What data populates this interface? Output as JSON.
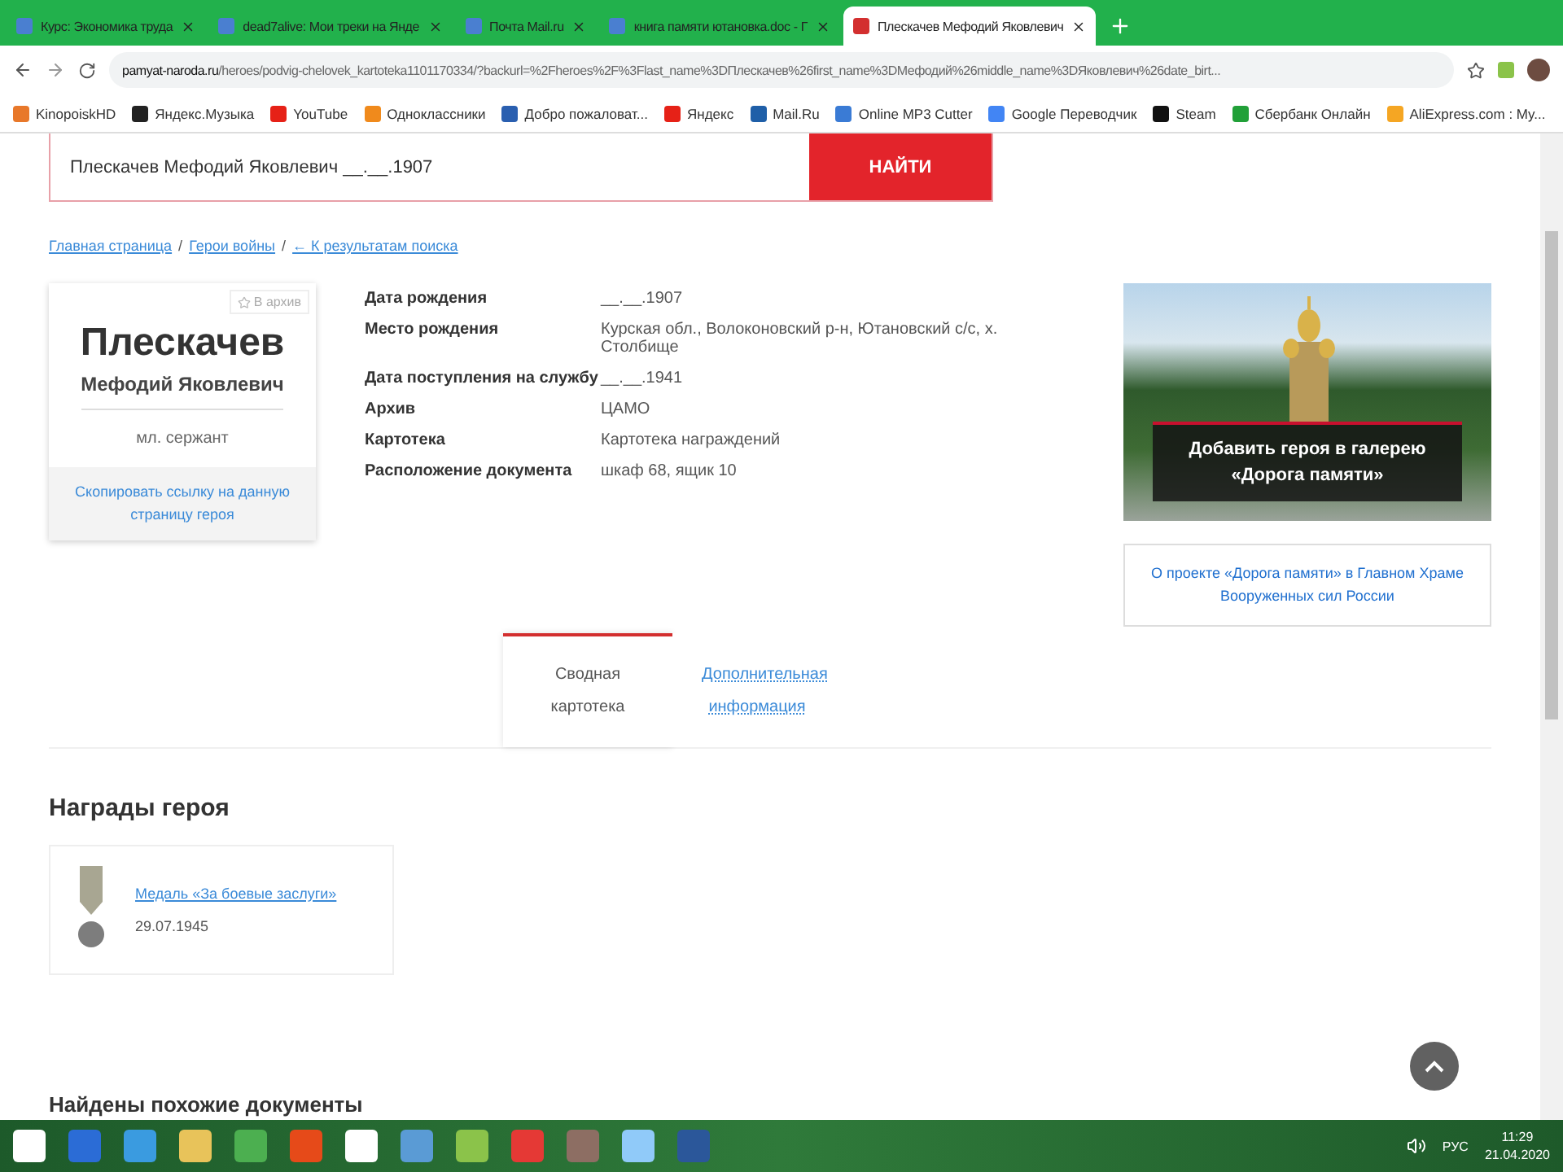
{
  "browser_tabs": [
    {
      "title": "Курс: Экономика труда",
      "selected": false
    },
    {
      "title": "dead7alive: Мои треки на Янде",
      "selected": false
    },
    {
      "title": "Почта Mail.ru",
      "selected": false
    },
    {
      "title": "книга памяти ютановка.doc - Г",
      "selected": false
    },
    {
      "title": "Плескачев Мефодий Яковлевич",
      "selected": true
    }
  ],
  "address": {
    "host": "pamyat-naroda.ru",
    "path": "/heroes/podvig-chelovek_kartoteka1101170334/?backurl=%2Fheroes%2F%3Flast_name%3DПлескачев%26first_name%3DМефодий%26middle_name%3DЯковлевич%26date_birt..."
  },
  "bookmarks": [
    {
      "label": "KinopoiskHD",
      "color": "#e8782a"
    },
    {
      "label": "Яндекс.Музыка",
      "color": "#222222"
    },
    {
      "label": "YouTube",
      "color": "#e62117"
    },
    {
      "label": "Одноклассники",
      "color": "#f08a1c"
    },
    {
      "label": "Добро пожаловат...",
      "color": "#2a5fb0"
    },
    {
      "label": "Яндекс",
      "color": "#e62117"
    },
    {
      "label": "Mail.Ru",
      "color": "#1f5fa8"
    },
    {
      "label": "Online MP3 Cutter",
      "color": "#3a7bd5"
    },
    {
      "label": "Google Переводчик",
      "color": "#4285f4"
    },
    {
      "label": "Steam",
      "color": "#111111"
    },
    {
      "label": "Сбербанк Онлайн",
      "color": "#21a038"
    },
    {
      "label": "AliExpress.com : My...",
      "color": "#f5a623"
    }
  ],
  "search": {
    "value": "Плескачев Мефодий Яковлевич __.__.1907",
    "button": "НАЙТИ"
  },
  "breadcrumbs": [
    "Главная страница",
    "Герои войны",
    "← К результатам поиска"
  ],
  "breadcrumb_separator": "/",
  "hero": {
    "archive_badge": "В архив",
    "last_name": "Плескачев",
    "first_names": "Мефодий Яковлевич",
    "rank": "мл. сержант",
    "copy_link": "Скопировать ссылку на данную страницу героя"
  },
  "details": [
    {
      "label": "Дата рождения",
      "value": "__.__.1907"
    },
    {
      "label": "Место рождения",
      "value": "Курская обл., Волоконовский р-н, Ютановский с/с, х. Столбище"
    },
    {
      "label": "Дата поступления на службу",
      "value": "__.__.1941"
    },
    {
      "label": "Архив",
      "value": "ЦАМО"
    },
    {
      "label": "Картотека",
      "value": "Картотека награждений"
    },
    {
      "label": "Расположение документа",
      "value": "шкаф 68, ящик 10"
    }
  ],
  "banner": {
    "caption": "Добавить героя в галерею «Дорога памяти»"
  },
  "project_link": "О проекте «Дорога памяти» в Главном Храме Вооруженных сил России",
  "content_tabs": [
    {
      "label": "Сводная картотека",
      "selected": true
    },
    {
      "label": "Дополнительная информация",
      "selected": false
    }
  ],
  "awards": {
    "title": "Награды героя",
    "items": [
      {
        "name": "Медаль «За боевые заслуги»",
        "date": "29.07.1945"
      }
    ]
  },
  "similar_title": "Найдены похожие документы",
  "taskbar": {
    "language": "РУС",
    "time": "11:29",
    "date": "21.04.2020"
  }
}
